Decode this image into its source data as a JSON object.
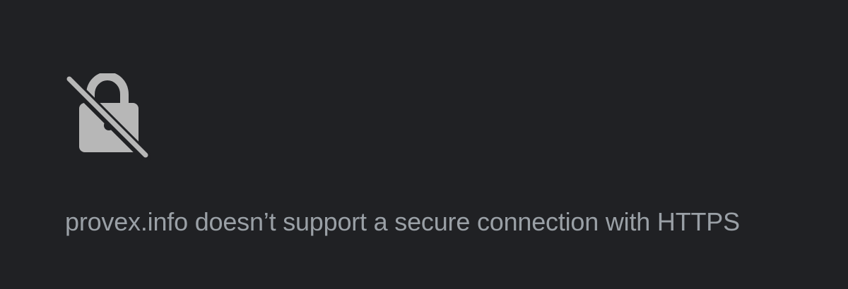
{
  "error_page": {
    "icon": "insecure-lock-icon",
    "message": "provex.info doesn’t support a secure connection with HTTPS"
  },
  "colors": {
    "background": "#202124",
    "icon": "#b7b7b7",
    "text": "#9aa0a6"
  }
}
